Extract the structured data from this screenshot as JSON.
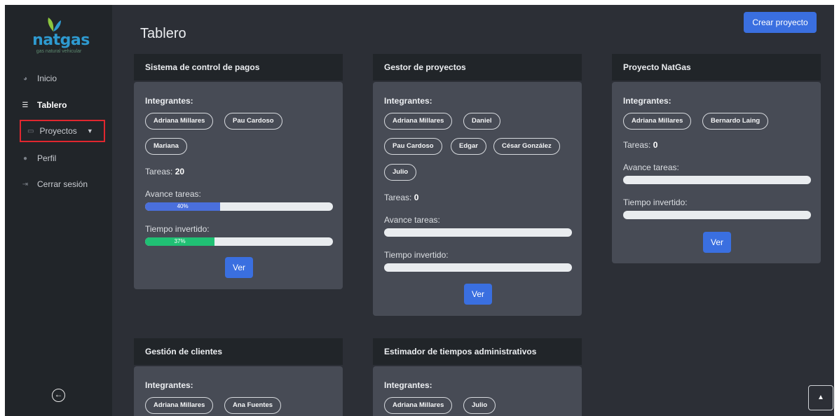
{
  "sidebar": {
    "logo_text": "natgas",
    "logo_tagline": "gas natural vehicular",
    "items": [
      {
        "label": "Inicio",
        "icon": "gauge-icon"
      },
      {
        "label": "Tablero",
        "icon": "list-icon"
      },
      {
        "label": "Proyectos",
        "icon": "folder-icon"
      },
      {
        "label": "Perfil",
        "icon": "user-icon"
      },
      {
        "label": "Cerrar sesión",
        "icon": "logout-icon"
      }
    ],
    "collapse_icon": "arrow-left-circle-icon"
  },
  "header": {
    "title": "Tablero",
    "create_label": "Crear proyecto"
  },
  "common": {
    "members_label": "Integrantes:",
    "tasks_label": "Tareas:",
    "progress_label": "Avance tareas:",
    "time_label": "Tiempo invertido:",
    "view_label": "Ver"
  },
  "projects": [
    {
      "name": "Sistema de control de pagos",
      "members": [
        "Adriana Millares",
        "Pau Cardoso",
        "Mariana"
      ],
      "tasks": "20",
      "progress": 40,
      "progress_text": "40%",
      "time": 37,
      "time_text": "37%"
    },
    {
      "name": "Gestor de proyectos",
      "members": [
        "Adriana Millares",
        "Daniel",
        "Pau Cardoso",
        "Edgar",
        "César González",
        "Julio"
      ],
      "tasks": "0",
      "progress": 0,
      "time": 0
    },
    {
      "name": "Proyecto NatGas",
      "members": [
        "Adriana Millares",
        "Bernardo Laing"
      ],
      "tasks": "0",
      "progress": 0,
      "time": 0
    },
    {
      "name": "Gestión de clientes",
      "members": [
        "Adriana Millares",
        "Ana Fuentes"
      ]
    },
    {
      "name": "Estimador de tiempos administrativos",
      "members": [
        "Adriana Millares",
        "Julio"
      ]
    }
  ],
  "colors": {
    "progress_fill": "#4a6fdc",
    "time_fill": "#20c074",
    "highlight_box": "#e0272f",
    "button": "#3a6fe0"
  },
  "scroll_top_icon": "caret-up-icon"
}
